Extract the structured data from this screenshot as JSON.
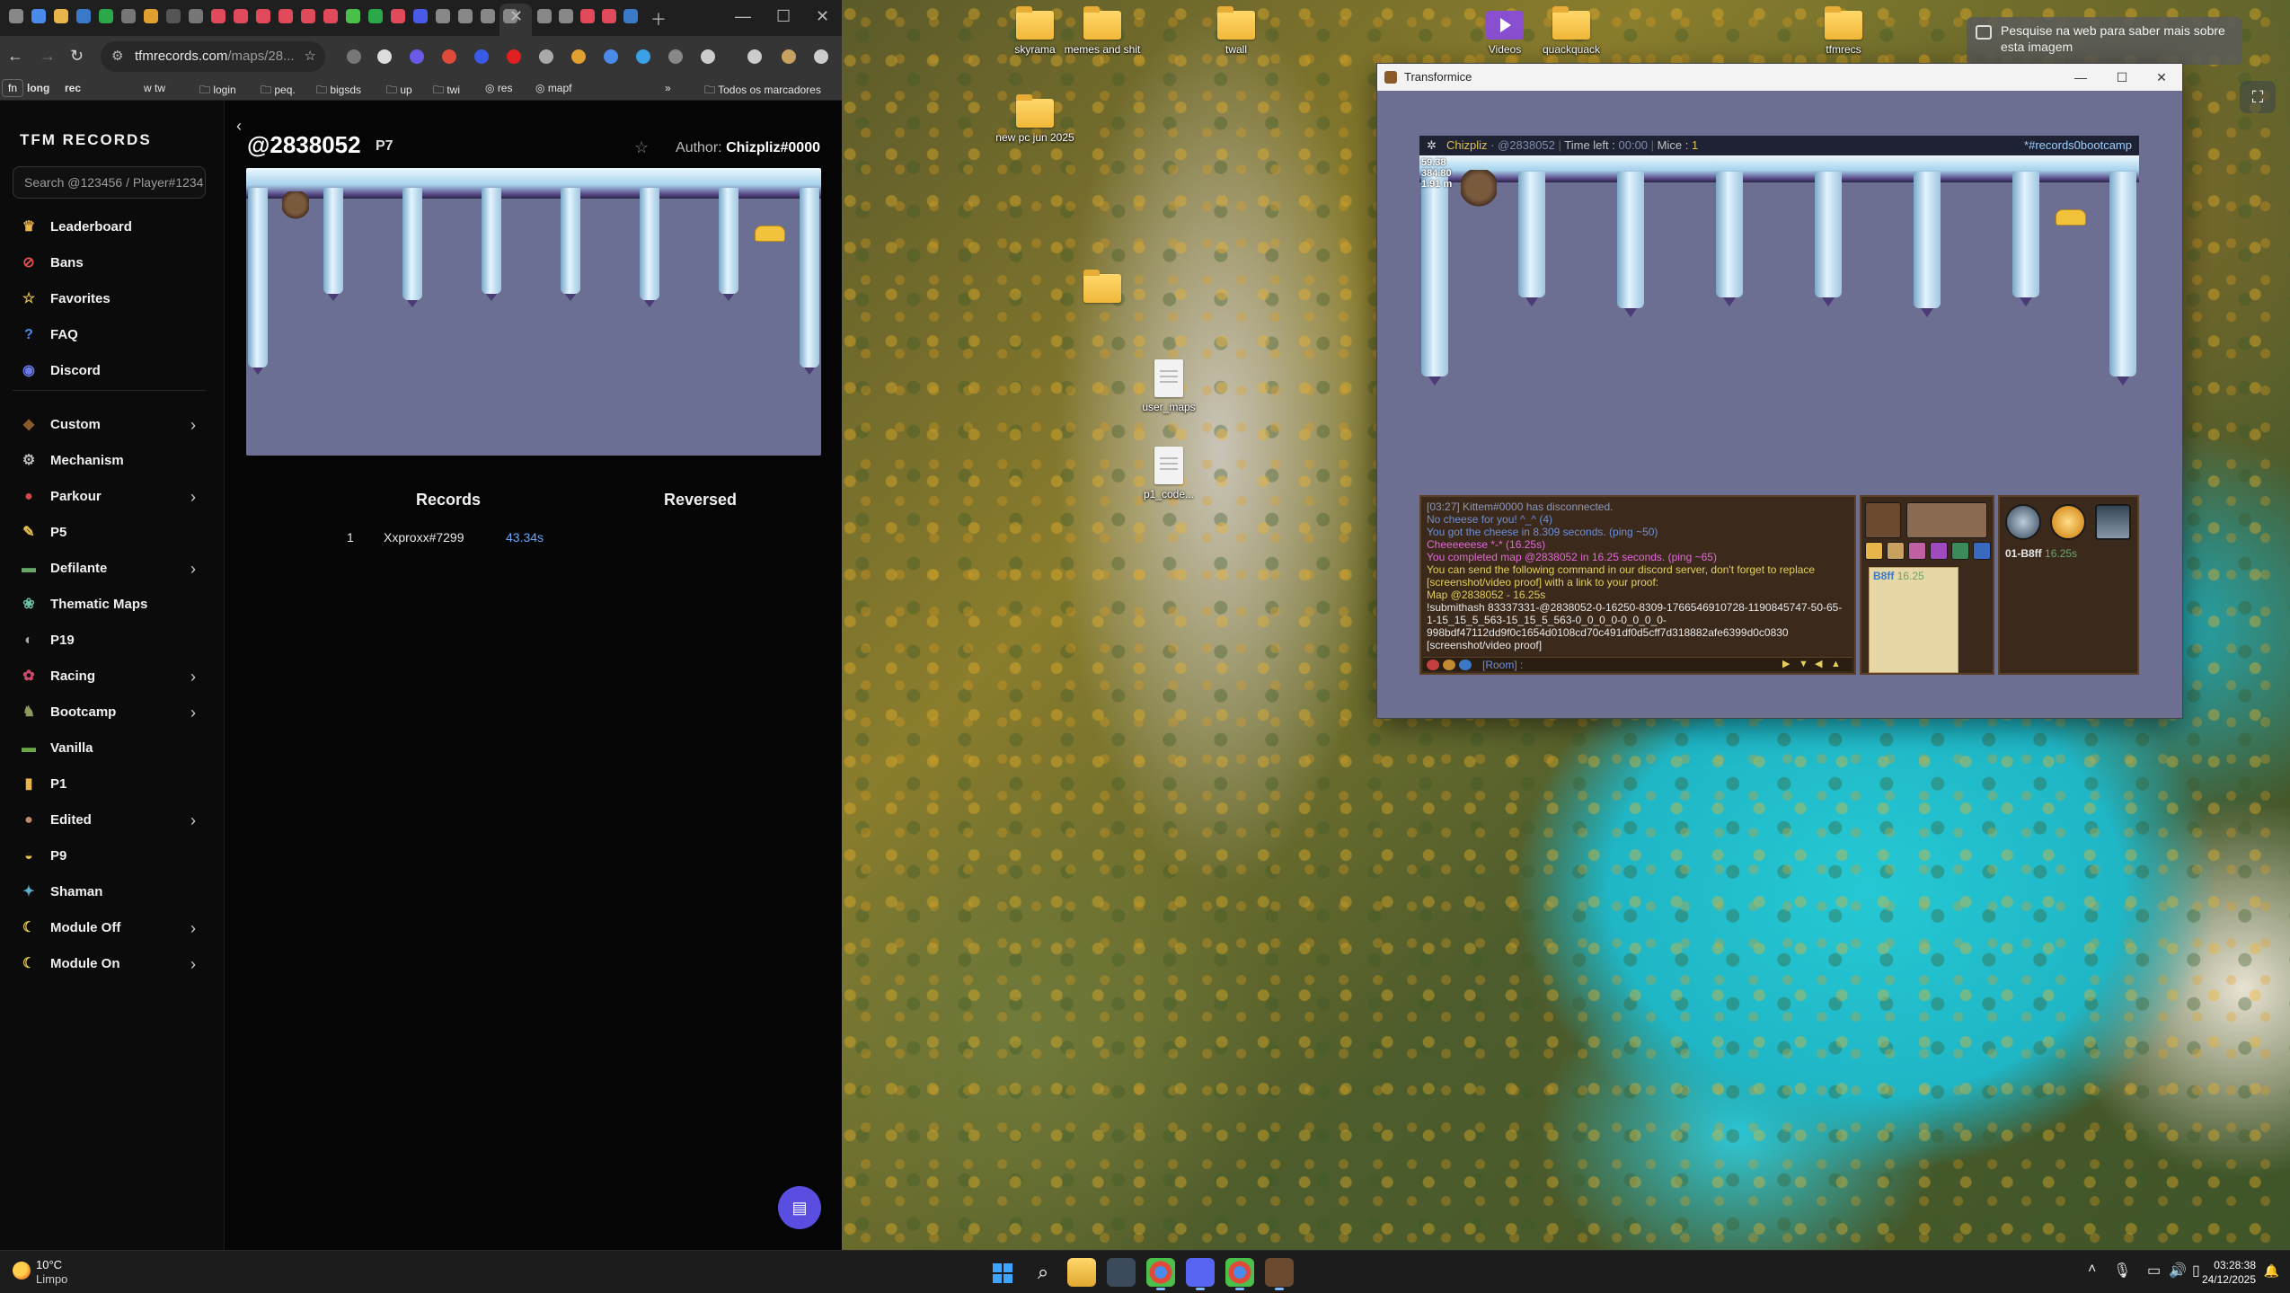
{
  "browser": {
    "url_host": "tfmrecords.com",
    "url_path": "/maps/28...",
    "bookmarks": [
      {
        "label": "fn",
        "pill": true
      },
      {
        "label": "long",
        "pill": false
      },
      {
        "label": "rec",
        "pill": false
      },
      {
        "label": "tw",
        "pill": false
      },
      {
        "label": "login",
        "pill": false
      },
      {
        "label": "peq.",
        "pill": false
      },
      {
        "label": "bigsds",
        "pill": false
      },
      {
        "label": "up",
        "pill": false
      },
      {
        "label": "twi",
        "pill": false
      },
      {
        "label": "res",
        "pill": false
      },
      {
        "label": "mapf",
        "pill": false
      }
    ],
    "bookmarks_more": "»",
    "all_bookmarks": "Todos os marcadores"
  },
  "site": {
    "brand": "TFM RECORDS",
    "search_placeholder": "Search @123456 / Player#1234",
    "nav_primary": [
      {
        "label": "Leaderboard",
        "icon": "crown-icon",
        "glyph": "♛",
        "color": "#e8b54a"
      },
      {
        "label": "Bans",
        "icon": "ban-icon",
        "glyph": "⊘",
        "color": "#e05050"
      },
      {
        "label": "Favorites",
        "icon": "star-icon",
        "glyph": "☆",
        "color": "#e8c24a"
      },
      {
        "label": "FAQ",
        "icon": "question-icon",
        "glyph": "?",
        "color": "#4a8ce8"
      },
      {
        "label": "Discord",
        "icon": "discord-icon",
        "glyph": "◉",
        "color": "#6a78e8"
      }
    ],
    "nav_categories": [
      {
        "label": "Custom",
        "icon": "custom-icon",
        "glyph": "◆",
        "color": "#8b5a2b",
        "expandable": true
      },
      {
        "label": "Mechanism",
        "icon": "gear-icon",
        "glyph": "⚙",
        "color": "#bbbbbb",
        "expandable": false
      },
      {
        "label": "Parkour",
        "icon": "parkour-icon",
        "glyph": "●",
        "color": "#d04a4a",
        "expandable": true
      },
      {
        "label": "P5",
        "icon": "brush-icon",
        "glyph": "✎",
        "color": "#e8c24a",
        "expandable": false
      },
      {
        "label": "Defilante",
        "icon": "defilante-icon",
        "glyph": "▬",
        "color": "#6aa56a",
        "expandable": true
      },
      {
        "label": "Thematic Maps",
        "icon": "thematic-icon",
        "glyph": "❀",
        "color": "#6ac0a0",
        "expandable": false
      },
      {
        "label": "P19",
        "icon": "p19-icon",
        "glyph": "◐",
        "color": "#aaaaaa",
        "expandable": false
      },
      {
        "label": "Racing",
        "icon": "racing-icon",
        "glyph": "✿",
        "color": "#d04a6a",
        "expandable": true
      },
      {
        "label": "Bootcamp",
        "icon": "bootcamp-icon",
        "glyph": "♞",
        "color": "#8a9a5a",
        "expandable": true
      },
      {
        "label": "Vanilla",
        "icon": "vanilla-icon",
        "glyph": "▬",
        "color": "#6aa54a",
        "expandable": false
      },
      {
        "label": "P1",
        "icon": "p1-icon",
        "glyph": "▮",
        "color": "#e8b54a",
        "expandable": false
      },
      {
        "label": "Edited",
        "icon": "edited-icon",
        "glyph": "●",
        "color": "#c08a6a",
        "expandable": true
      },
      {
        "label": "P9",
        "icon": "p9-icon",
        "glyph": "◒",
        "color": "#e8c24a",
        "expandable": false
      },
      {
        "label": "Shaman",
        "icon": "shaman-icon",
        "glyph": "✦",
        "color": "#5ab0c8",
        "expandable": false
      },
      {
        "label": "Module Off",
        "icon": "moon-icon",
        "glyph": "☾",
        "color": "#e8c24a",
        "expandable": true
      },
      {
        "label": "Module On",
        "icon": "moon-icon",
        "glyph": "☾",
        "color": "#e8c24a",
        "expandable": true
      }
    ],
    "map": {
      "code": "@2838052",
      "category": "P7",
      "author_label": "Author:",
      "author": "Chizpliz#0000"
    },
    "tabs": {
      "records": "Records",
      "reversed": "Reversed"
    },
    "records": [
      {
        "rank": "1",
        "player": "Xxproxx#7299",
        "time": "43.34s"
      }
    ]
  },
  "desktop": {
    "icons": [
      {
        "label": "skyrama",
        "kind": "folder"
      },
      {
        "label": "memes and shit",
        "kind": "folder"
      },
      {
        "label": "twall",
        "kind": "folder"
      },
      {
        "label": "Videos",
        "kind": "video"
      },
      {
        "label": "quackquack",
        "kind": "folder"
      },
      {
        "label": "tfmrecs",
        "kind": "folder"
      },
      {
        "label": "new pc jun 2025",
        "kind": "folder"
      },
      {
        "label": "",
        "kind": "folder"
      },
      {
        "label": "user_maps",
        "kind": "file"
      },
      {
        "label": "p1_code...",
        "kind": "file"
      }
    ],
    "lens_popup": "Pesquise na web para saber mais sobre esta imagem"
  },
  "tfm": {
    "window_title": "Transformice",
    "hud": {
      "player": "Chizpliz",
      "player_code": "· @2838052",
      "time_left_label": "Time left :",
      "time_left": "00:00",
      "mice_label": "Mice :",
      "mice": "1",
      "room": "*#records0bootcamp"
    },
    "stats": [
      "59.38",
      "384.80",
      "1.91 m"
    ],
    "chat": [
      {
        "text": "[03:27] Kittem#0000 has disconnected.",
        "cls": "c-gray"
      },
      {
        "text": "No cheese for you! ^_^ (4)",
        "cls": "c-blue"
      },
      {
        "text": "You got the cheese in 8.309 seconds. (ping ~50)",
        "cls": "c-blue"
      },
      {
        "text": "Cheeeeeese *-* (16.25s)",
        "cls": "c-pink"
      },
      {
        "text": "You completed map @2838052 in 16.25 seconds. (ping ~65)",
        "cls": "c-pink"
      },
      {
        "text": "You can send the following command in our discord server, don't forget to replace [screenshot/video proof] with a link to your proof:",
        "cls": "c-yellow"
      },
      {
        "text": "Map @2838052 - 16.25s",
        "cls": "c-yellow"
      },
      {
        "text": "!submithash 83337331-@2838052-0-16250-8309-1766546910728-1190845747-50-65-1-15_15_5_563-15_15_5_563-0_0_0_0-0_0_0_0-998bdf47112dd9f0c1654d0108cd70c491df0d5cff7d318882afe6399d0c0830 [screenshot/video proof]",
        "cls": "c-white"
      }
    ],
    "chat_input": "[Room] :",
    "player_note_name": "B8ff",
    "player_note_time": "16.25",
    "shop_name": "01-B8ff",
    "shop_time": "16.25s"
  },
  "taskbar": {
    "temp": "10°C",
    "weather": "Limpo",
    "time": "03:28:38",
    "date": "24/12/2025"
  }
}
